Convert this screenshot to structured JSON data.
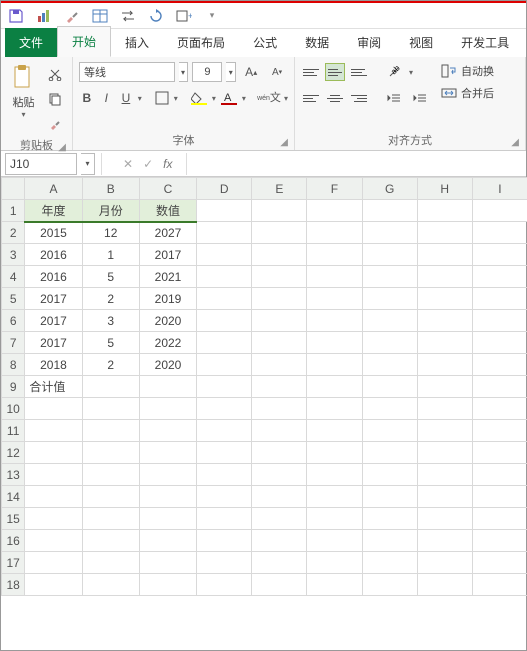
{
  "qat": {
    "icons": [
      "save-icon",
      "bar-chart-icon",
      "brush-icon",
      "table-icon",
      "switch-icon",
      "refresh-icon",
      "add-sheet-icon"
    ]
  },
  "tabs": {
    "file": "文件",
    "items": [
      "开始",
      "插入",
      "页面布局",
      "公式",
      "数据",
      "审阅",
      "视图",
      "开发工具"
    ],
    "activeIndex": 0
  },
  "ribbon": {
    "clipboard": {
      "paste": "粘贴",
      "label": "剪贴板"
    },
    "font": {
      "name": "等线",
      "size": "9",
      "label": "字体"
    },
    "alignment": {
      "wrap": "自动换",
      "merge": "合并后",
      "label": "对齐方式"
    }
  },
  "formula_bar": {
    "namebox": "J10",
    "fx": "fx",
    "value": ""
  },
  "grid": {
    "columns": [
      "A",
      "B",
      "C",
      "D",
      "E",
      "F",
      "G",
      "H",
      "I"
    ],
    "header_row": [
      "年度",
      "月份",
      "数值"
    ],
    "data_rows": [
      [
        "2015",
        "12",
        "2027"
      ],
      [
        "2016",
        "1",
        "2017"
      ],
      [
        "2016",
        "5",
        "2021"
      ],
      [
        "2017",
        "2",
        "2019"
      ],
      [
        "2017",
        "3",
        "2020"
      ],
      [
        "2017",
        "5",
        "2022"
      ],
      [
        "2018",
        "2",
        "2020"
      ]
    ],
    "total_label": "合计值",
    "visible_rows": 18
  },
  "chart_data": {
    "type": "table",
    "title": "",
    "columns": [
      "年度",
      "月份",
      "数值"
    ],
    "rows": [
      [
        2015,
        12,
        2027
      ],
      [
        2016,
        1,
        2017
      ],
      [
        2016,
        5,
        2021
      ],
      [
        2017,
        2,
        2019
      ],
      [
        2017,
        3,
        2020
      ],
      [
        2017,
        5,
        2022
      ],
      [
        2018,
        2,
        2020
      ]
    ]
  }
}
